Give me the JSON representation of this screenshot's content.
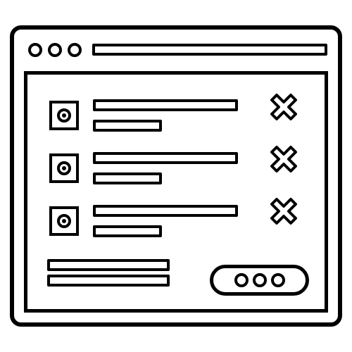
{
  "window": {
    "icon": "browser-window-icon",
    "title_bar_dots": [
      "window-dot-icon",
      "window-dot-icon",
      "window-dot-icon"
    ]
  },
  "list": {
    "items": [
      {
        "checkbox_icon": "radio-checkbox-icon",
        "delete_icon": "close-icon"
      },
      {
        "checkbox_icon": "radio-checkbox-icon",
        "delete_icon": "close-icon"
      },
      {
        "checkbox_icon": "radio-checkbox-icon",
        "delete_icon": "close-icon"
      }
    ]
  },
  "footer": {
    "button_icon": "more-options-icon"
  },
  "colors": {
    "stroke": "#000000",
    "background": "#ffffff"
  }
}
